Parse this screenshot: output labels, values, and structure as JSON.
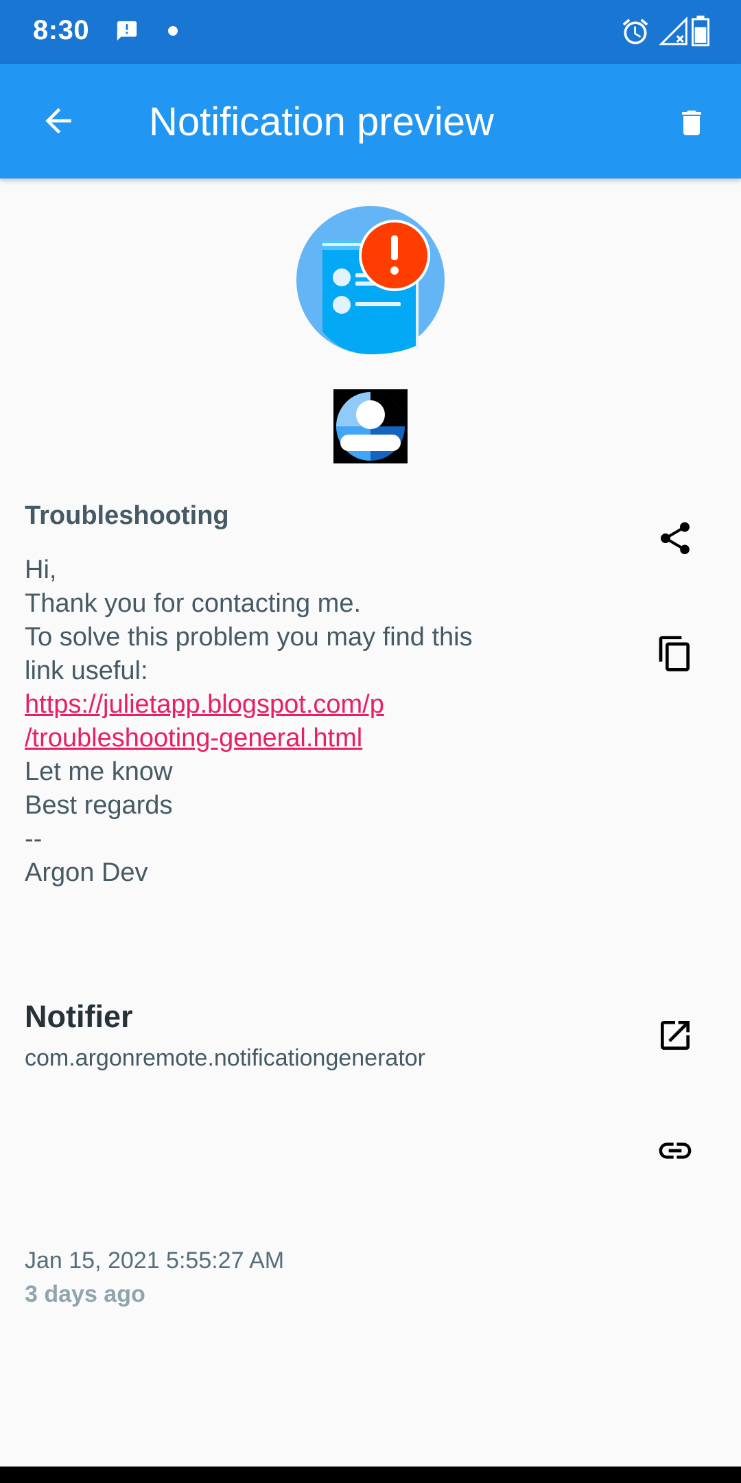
{
  "status_bar": {
    "time": "8:30",
    "icons": [
      "message-alert-icon",
      "dot-icon",
      "alarm-icon",
      "signal-icon",
      "battery-icon"
    ]
  },
  "app_bar": {
    "title": "Notification preview",
    "icons": [
      "arrow-back-icon",
      "delete-icon"
    ],
    "background": "#2196f3"
  },
  "notification": {
    "title": "Troubleshooting",
    "body_lines": [
      "Hi,",
      "Thank you for contacting me.",
      "To solve this problem you may find this",
      "link useful:"
    ],
    "link_lines": [
      "https://julietapp.blogspot.com/p",
      "/troubleshooting-general.html"
    ],
    "closing_lines": [
      "Let me know",
      "Best regards",
      "--",
      "Argon Dev"
    ],
    "link_color": "#e91e63"
  },
  "app_info": {
    "name": "Notifier",
    "package": "com.argonremote.notificationgenerator"
  },
  "time_info": {
    "timestamp": "Jan 15, 2021 5:55:27 AM",
    "relative": "3 days ago"
  },
  "actions": [
    "share-icon",
    "copy-icon",
    "open-in-new-icon",
    "link-icon"
  ]
}
